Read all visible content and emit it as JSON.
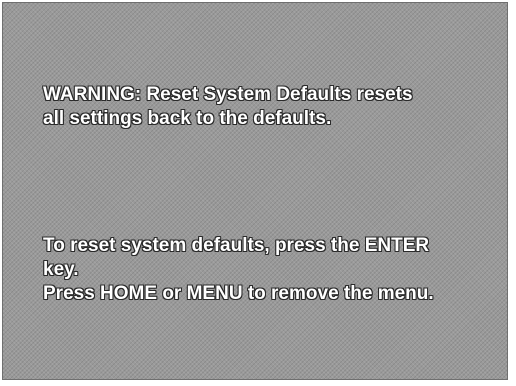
{
  "warning": {
    "line1": "WARNING:  Reset System Defaults resets",
    "line2": "all settings back to the defaults."
  },
  "instructions": {
    "line1": "To reset system defaults, press the ENTER",
    "line2": "key.",
    "line3": "Press HOME or MENU to remove the menu."
  }
}
